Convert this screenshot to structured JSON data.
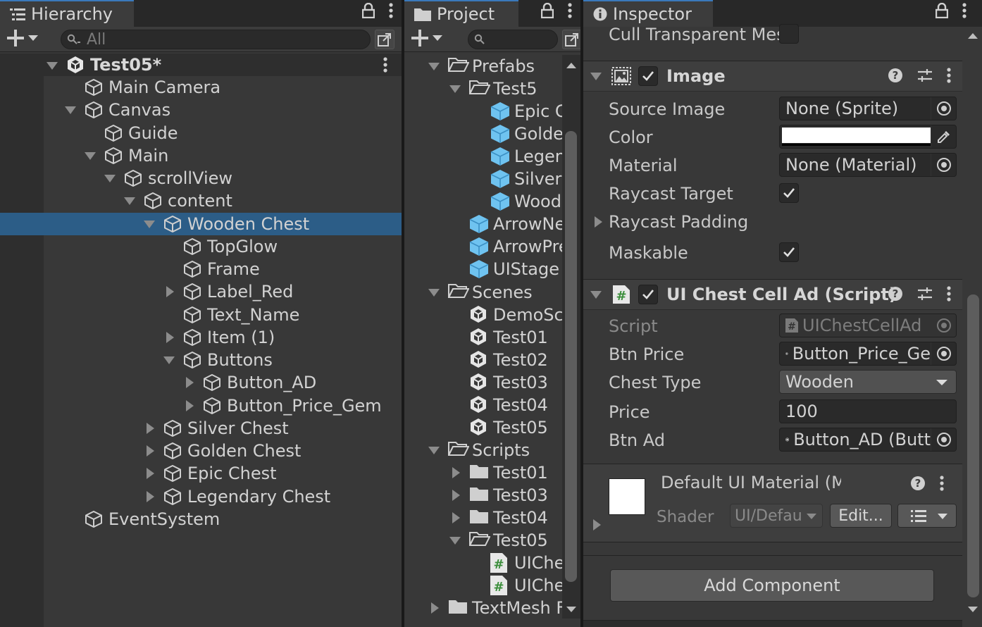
{
  "hierarchy": {
    "tab_label": "Hierarchy",
    "search_placeholder": "All",
    "scene_name": "Test05*",
    "rows": [
      {
        "label": "Main Camera",
        "depth": 1,
        "arrow": "none",
        "icon": "gameobject",
        "selected": false
      },
      {
        "label": "Canvas",
        "depth": 1,
        "arrow": "down",
        "icon": "gameobject",
        "selected": false
      },
      {
        "label": "Guide",
        "depth": 2,
        "arrow": "none",
        "icon": "gameobject",
        "selected": false
      },
      {
        "label": "Main",
        "depth": 2,
        "arrow": "down",
        "icon": "gameobject",
        "selected": false
      },
      {
        "label": "scrollView",
        "depth": 3,
        "arrow": "down",
        "icon": "gameobject",
        "selected": false
      },
      {
        "label": "content",
        "depth": 4,
        "arrow": "down",
        "icon": "gameobject",
        "selected": false
      },
      {
        "label": "Wooden Chest",
        "depth": 5,
        "arrow": "down",
        "icon": "gameobject",
        "selected": true
      },
      {
        "label": "TopGlow",
        "depth": 6,
        "arrow": "none",
        "icon": "gameobject",
        "selected": false
      },
      {
        "label": "Frame",
        "depth": 6,
        "arrow": "none",
        "icon": "gameobject",
        "selected": false
      },
      {
        "label": "Label_Red",
        "depth": 6,
        "arrow": "right",
        "icon": "gameobject",
        "selected": false
      },
      {
        "label": "Text_Name",
        "depth": 6,
        "arrow": "none",
        "icon": "gameobject",
        "selected": false
      },
      {
        "label": "Item (1)",
        "depth": 6,
        "arrow": "right",
        "icon": "gameobject",
        "selected": false
      },
      {
        "label": "Buttons",
        "depth": 6,
        "arrow": "down",
        "icon": "gameobject",
        "selected": false
      },
      {
        "label": "Button_AD",
        "depth": 7,
        "arrow": "right",
        "icon": "gameobject",
        "selected": false
      },
      {
        "label": "Button_Price_Gem",
        "depth": 7,
        "arrow": "right",
        "icon": "gameobject",
        "selected": false
      },
      {
        "label": "Silver Chest",
        "depth": 5,
        "arrow": "right",
        "icon": "gameobject",
        "selected": false
      },
      {
        "label": "Golden Chest",
        "depth": 5,
        "arrow": "right",
        "icon": "gameobject",
        "selected": false
      },
      {
        "label": "Epic Chest",
        "depth": 5,
        "arrow": "right",
        "icon": "gameobject",
        "selected": false
      },
      {
        "label": "Legendary Chest",
        "depth": 5,
        "arrow": "right",
        "icon": "gameobject",
        "selected": false
      },
      {
        "label": "EventSystem",
        "depth": 1,
        "arrow": "none",
        "icon": "gameobject",
        "selected": false
      }
    ]
  },
  "project": {
    "tab_label": "Project",
    "rows": [
      {
        "label": "Prefabs",
        "depth": 1,
        "arrow": "down",
        "icon": "folder-open"
      },
      {
        "label": "Test5",
        "depth": 2,
        "arrow": "down",
        "icon": "folder-open"
      },
      {
        "label": "Epic C",
        "depth": 3,
        "arrow": "none",
        "icon": "prefab"
      },
      {
        "label": "Golde",
        "depth": 3,
        "arrow": "none",
        "icon": "prefab"
      },
      {
        "label": "Legen",
        "depth": 3,
        "arrow": "none",
        "icon": "prefab"
      },
      {
        "label": "Silver",
        "depth": 3,
        "arrow": "none",
        "icon": "prefab"
      },
      {
        "label": "Woode",
        "depth": 3,
        "arrow": "none",
        "icon": "prefab"
      },
      {
        "label": "ArrowNe",
        "depth": 2,
        "arrow": "none",
        "icon": "prefab"
      },
      {
        "label": "ArrowPre",
        "depth": 2,
        "arrow": "none",
        "icon": "prefab"
      },
      {
        "label": "UIStage",
        "depth": 2,
        "arrow": "none",
        "icon": "prefab"
      },
      {
        "label": "Scenes",
        "depth": 1,
        "arrow": "down",
        "icon": "folder-open"
      },
      {
        "label": "DemoSc",
        "depth": 2,
        "arrow": "none",
        "icon": "scene"
      },
      {
        "label": "Test01",
        "depth": 2,
        "arrow": "none",
        "icon": "scene"
      },
      {
        "label": "Test02",
        "depth": 2,
        "arrow": "none",
        "icon": "scene"
      },
      {
        "label": "Test03",
        "depth": 2,
        "arrow": "none",
        "icon": "scene"
      },
      {
        "label": "Test04",
        "depth": 2,
        "arrow": "none",
        "icon": "scene"
      },
      {
        "label": "Test05",
        "depth": 2,
        "arrow": "none",
        "icon": "scene"
      },
      {
        "label": "Scripts",
        "depth": 1,
        "arrow": "down",
        "icon": "folder-open"
      },
      {
        "label": "Test01",
        "depth": 2,
        "arrow": "right",
        "icon": "folder"
      },
      {
        "label": "Test03",
        "depth": 2,
        "arrow": "right",
        "icon": "folder"
      },
      {
        "label": "Test04",
        "depth": 2,
        "arrow": "right",
        "icon": "folder"
      },
      {
        "label": "Test05",
        "depth": 2,
        "arrow": "down",
        "icon": "folder-open"
      },
      {
        "label": "UIChe",
        "depth": 3,
        "arrow": "none",
        "icon": "script"
      },
      {
        "label": "UIChe",
        "depth": 3,
        "arrow": "none",
        "icon": "script"
      },
      {
        "label": "TextMesh F",
        "depth": 1,
        "arrow": "right",
        "icon": "folder"
      }
    ]
  },
  "inspector": {
    "tab_label": "Inspector",
    "cull_label": "Cull Transparent Mes",
    "image": {
      "title": "Image",
      "source_image_label": "Source Image",
      "source_image_value": "None (Sprite)",
      "color_label": "Color",
      "color_value": "#ffffff",
      "material_label": "Material",
      "material_value": "None (Material)",
      "raycast_target_label": "Raycast Target",
      "raycast_padding_label": "Raycast Padding",
      "maskable_label": "Maskable"
    },
    "script_comp": {
      "title": "UI Chest Cell Ad (Script)",
      "script_label": "Script",
      "script_value": "UIChestCellAd",
      "btn_price_label": "Btn Price",
      "btn_price_value": "Button_Price_Ge",
      "chest_type_label": "Chest Type",
      "chest_type_value": "Wooden",
      "price_label": "Price",
      "price_value": "100",
      "btn_ad_label": "Btn Ad",
      "btn_ad_value": "Button_AD (Butt"
    },
    "material": {
      "title": "Default UI Material (Material)",
      "shader_label": "Shader",
      "shader_value": "UI/Defau",
      "edit_label": "Edit..."
    },
    "add_component_label": "Add Component"
  },
  "colors": {
    "selection": "#2c5d87",
    "prefab_blue": "#6fc3f0",
    "script_green": "#3b8e3b"
  }
}
